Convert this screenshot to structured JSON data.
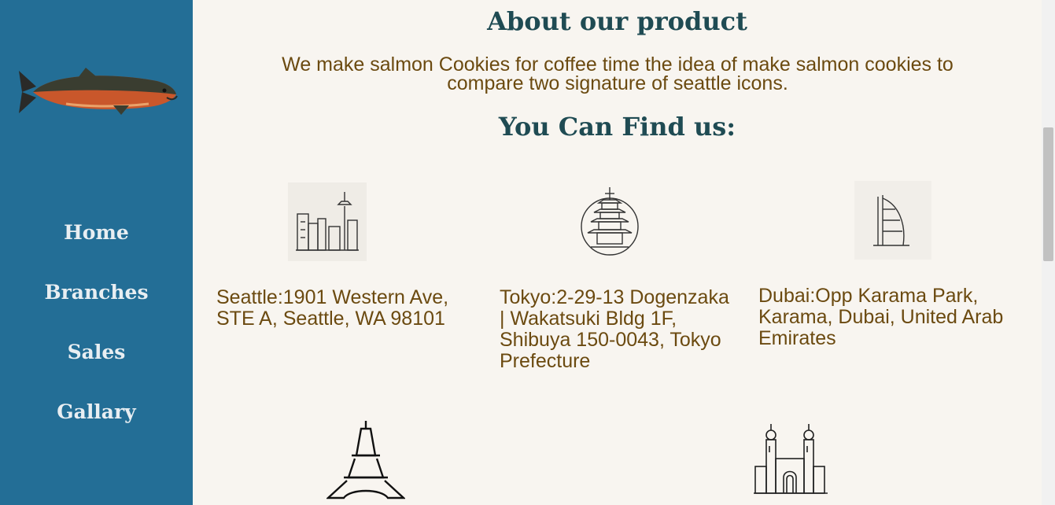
{
  "sidebar": {
    "logo_icon": "salmon-fish-icon",
    "nav": [
      "Home",
      "Branches",
      "Sales",
      "Gallary"
    ]
  },
  "main": {
    "about_title": "About our product",
    "about_text": "We make salmon Cookies for coffee time the idea of make salmon cookies to compare two signature of seattle icons.",
    "find_title": "You Can Find us:",
    "locations": [
      {
        "icon": "seattle-skyline-icon",
        "address": "Seattle:1901 Western Ave, STE A, Seattle, WA 98101"
      },
      {
        "icon": "tokyo-pagoda-icon",
        "address": "Tokyo:2-29-13 Dogenzaka | Wakatsuki Bldg 1F, Shibuya 150-0043, Tokyo Prefecture"
      },
      {
        "icon": "dubai-burj-al-arab-icon",
        "address": "Dubai:Opp Karama Park, Karama, Dubai, United Arab Emirates"
      },
      {
        "icon": "paris-eiffel-tower-icon",
        "address": ""
      },
      {
        "icon": "mosque-building-icon",
        "address": ""
      }
    ]
  },
  "colors": {
    "sidebar_bg": "#236e96",
    "page_bg": "#f8f5f0",
    "heading": "#1f4b53",
    "body_text": "#6b4a10",
    "nav_text": "#e8eef2"
  }
}
